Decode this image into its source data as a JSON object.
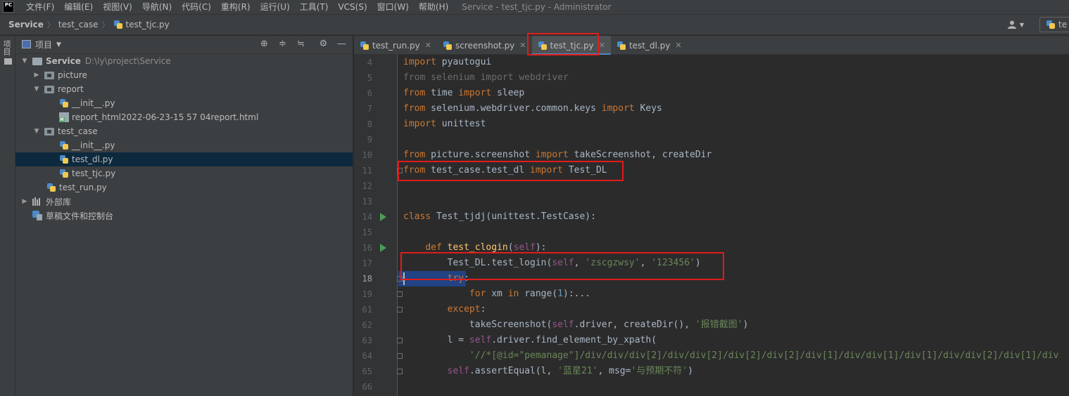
{
  "app": {
    "logo_text": "PC",
    "window_title": "Service - test_tjc.py - Administrator"
  },
  "menu": [
    "文件(F)",
    "编辑(E)",
    "视图(V)",
    "导航(N)",
    "代码(C)",
    "重构(R)",
    "运行(U)",
    "工具(T)",
    "VCS(S)",
    "窗口(W)",
    "帮助(H)"
  ],
  "breadcrumb": {
    "root": "Service",
    "folder": "test_case",
    "file": "test_tjc.py"
  },
  "nav_right": {
    "user_icon": "user-icon",
    "run_config_label": "te"
  },
  "tool_strip": {
    "project_label": "项目"
  },
  "project_panel": {
    "title": "项目",
    "actions": [
      "locate-icon",
      "expand-all-icon",
      "collapse-all-icon",
      "gear-icon",
      "minimize-icon"
    ],
    "tree": [
      {
        "label": "Service",
        "hint": "D:\\ly\\project\\Service",
        "kind": "root",
        "expanded": true
      },
      {
        "label": "picture",
        "kind": "folder",
        "expanded": false
      },
      {
        "label": "report",
        "kind": "folder",
        "expanded": true
      },
      {
        "label": "__init__.py",
        "kind": "py"
      },
      {
        "label": "report_html2022-06-23-15 57 04report.html",
        "kind": "html"
      },
      {
        "label": "test_case",
        "kind": "folder",
        "expanded": true
      },
      {
        "label": "__init__.py",
        "kind": "py"
      },
      {
        "label": "test_dl.py",
        "kind": "py",
        "selected": true
      },
      {
        "label": "test_tjc.py",
        "kind": "py"
      },
      {
        "label": "test_run.py",
        "kind": "py"
      },
      {
        "label": "外部库",
        "kind": "library",
        "expanded": false
      },
      {
        "label": "草稿文件和控制台",
        "kind": "scratch"
      }
    ]
  },
  "tabs": [
    {
      "label": "test_run.py",
      "active": false
    },
    {
      "label": "screenshot.py",
      "active": false
    },
    {
      "label": "test_tjc.py",
      "active": true
    },
    {
      "label": "test_dl.py",
      "active": false
    }
  ],
  "code": [
    {
      "ln": "4",
      "text": "import pyautogui"
    },
    {
      "ln": "5",
      "text": "from selenium import webdriver"
    },
    {
      "ln": "6",
      "text": "from time import sleep"
    },
    {
      "ln": "7",
      "text": "from selenium.webdriver.common.keys import Keys"
    },
    {
      "ln": "8",
      "text": "import unittest"
    },
    {
      "ln": "9",
      "text": ""
    },
    {
      "ln": "10",
      "text": "from picture.screenshot import takeScreenshot, createDir"
    },
    {
      "ln": "11",
      "text": "from test_case.test_dl import Test_DL"
    },
    {
      "ln": "12",
      "text": ""
    },
    {
      "ln": "13",
      "text": ""
    },
    {
      "ln": "14",
      "text": "class Test_tjdj(unittest.TestCase):"
    },
    {
      "ln": "15",
      "text": ""
    },
    {
      "ln": "16",
      "text": "    def test_clogin(self):"
    },
    {
      "ln": "17",
      "text": "        Test_DL.test_login(self, 'zscgzwsy', '123456')"
    },
    {
      "ln": "18",
      "text": "        try:"
    },
    {
      "ln": "19",
      "text": "            for xm in range(1):..."
    },
    {
      "ln": "61",
      "text": "        except:"
    },
    {
      "ln": "62",
      "text": "            takeScreenshot(self.driver, createDir(), '报错截图')"
    },
    {
      "ln": "63",
      "text": "        l = self.driver.find_element_by_xpath("
    },
    {
      "ln": "64",
      "text": "            '//*[@id=\"pemanage\"]/div/div/div[2]/div/div[2]/div[2]/div[2]/div[1]/div/div[1]/div[1]/div/div[2]/div[1]/div"
    },
    {
      "ln": "65",
      "text": "        self.assertEqual(l, '蓝星21', msg='与预期不符')"
    },
    {
      "ln": "66",
      "text": ""
    }
  ],
  "colors": {
    "annotation": "#e01b1b",
    "selection": "#214283",
    "keyword": "#cc7832",
    "string": "#6a8759"
  }
}
